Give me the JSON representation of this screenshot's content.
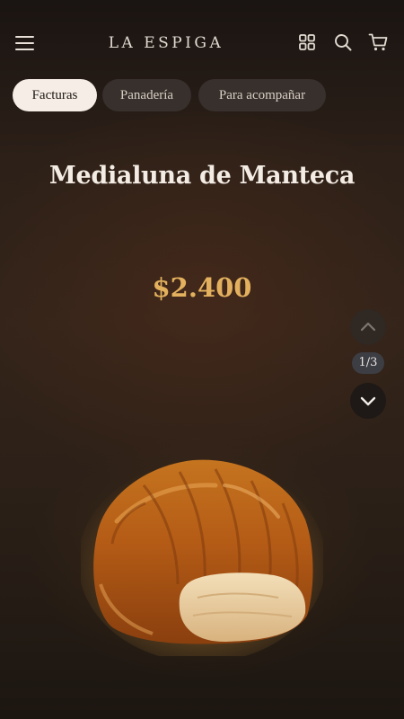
{
  "header": {
    "brand": "LA ESPIGA",
    "icons": {
      "menu": "hamburger-menu-icon",
      "grid": "grid-icon",
      "search": "search-icon",
      "cart": "cart-icon"
    }
  },
  "tabs": [
    {
      "label": "Facturas",
      "active": true
    },
    {
      "label": "Panadería",
      "active": false
    },
    {
      "label": "Para acompañar",
      "active": false
    }
  ],
  "product": {
    "name": "Medialuna de Manteca",
    "price": "$2.400",
    "image": "croissant"
  },
  "pager": {
    "counter": "1/3",
    "current": 1,
    "total": 3
  },
  "colors": {
    "background": "#2c2018",
    "price": "#e3b15e",
    "title": "#f3ece4",
    "active_tab": "#f5ede6",
    "inactive_tab": "#37302c"
  }
}
